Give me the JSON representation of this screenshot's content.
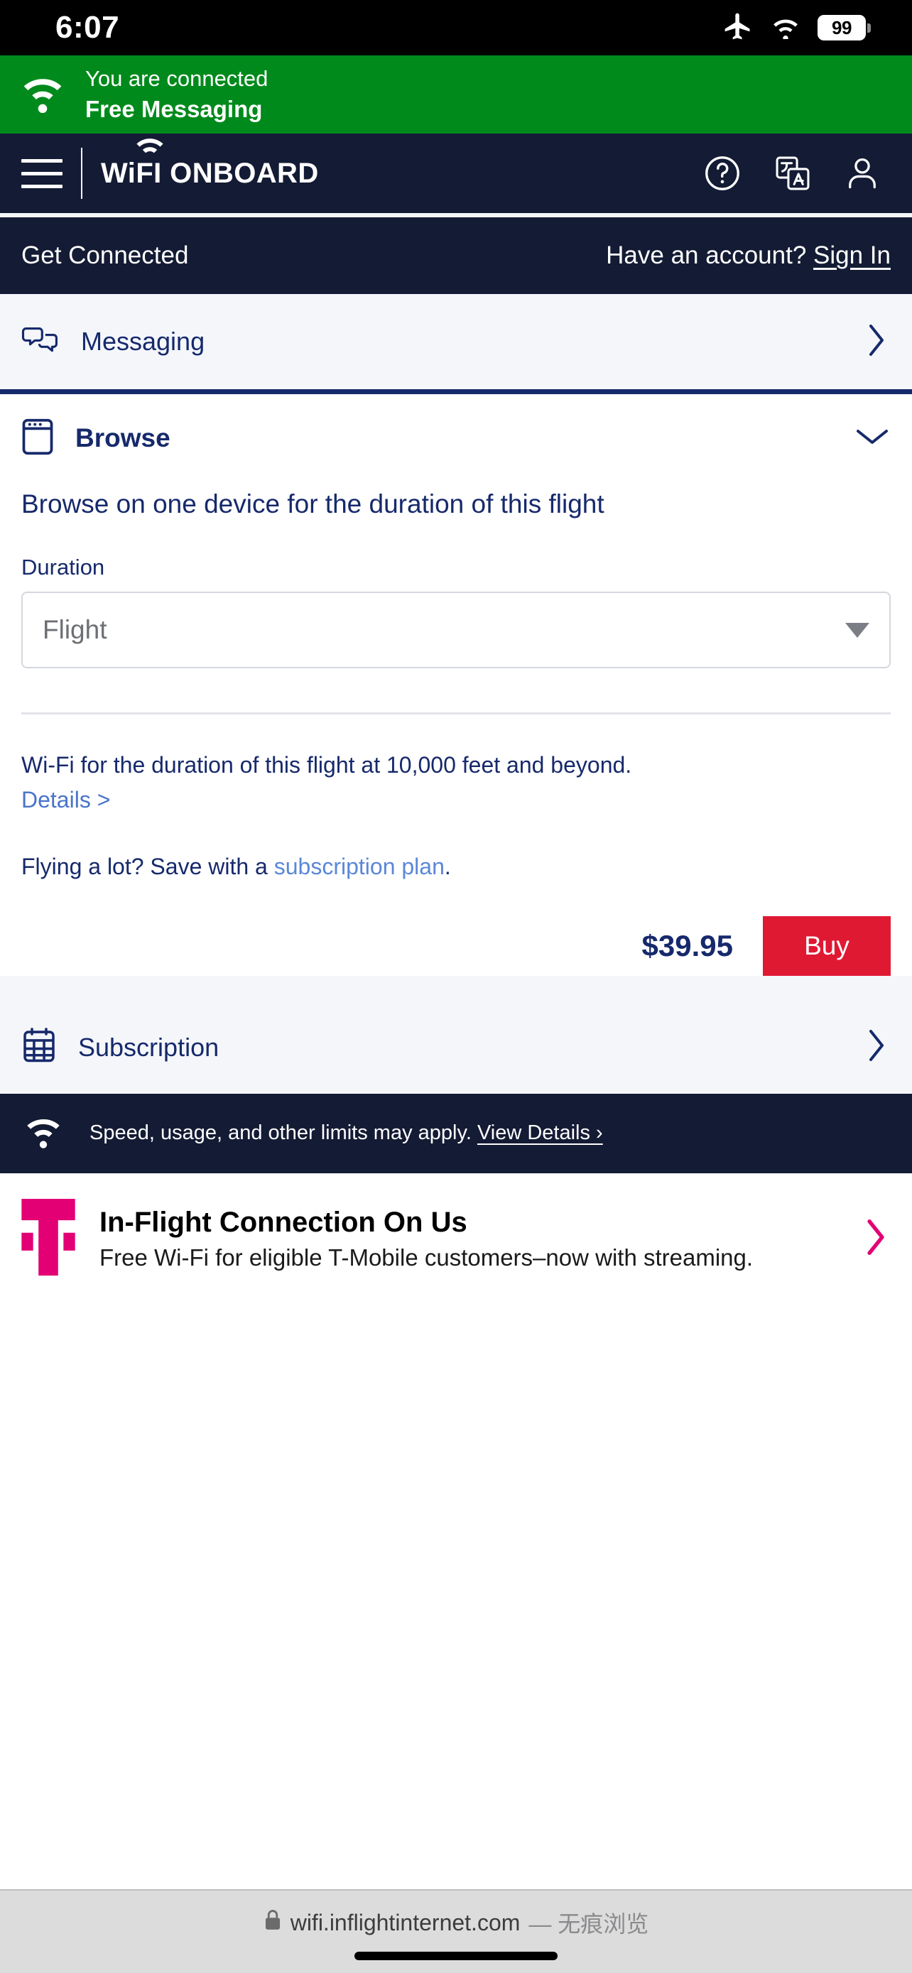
{
  "status_bar": {
    "time": "6:07",
    "icons": [
      "airplane-mode-icon",
      "wifi-icon"
    ],
    "battery_level": "99"
  },
  "connected_banner": {
    "icon": "wifi-icon",
    "line1": "You are connected",
    "line2": "Free Messaging",
    "background": "#008A1C"
  },
  "header": {
    "menu_icon": "hamburger-menu-icon",
    "brand": "WiFI ONBOARD",
    "icons": [
      {
        "name": "help-icon",
        "label": "?"
      },
      {
        "name": "translate-icon",
        "label": "文A"
      },
      {
        "name": "account-icon",
        "label": "person"
      }
    ],
    "background": "#141B34"
  },
  "subnav": {
    "title": "Get Connected",
    "account_prompt": "Have an account?",
    "sign_in": "Sign In"
  },
  "messaging_row": {
    "icon": "chat-bubbles-icon",
    "label": "Messaging",
    "chevron": "chevron-right-icon"
  },
  "browse": {
    "icon": "browser-window-icon",
    "title": "Browse",
    "chevron": "chevron-down-icon",
    "lead": "Browse on one device for the duration of this flight",
    "duration_label": "Duration",
    "duration_value": "Flight",
    "duration_options": [
      "Flight"
    ],
    "description": "Wi-Fi for the duration of this flight at 10,000 feet and beyond.",
    "details_link": "Details >",
    "subscription_prompt_prefix": "Flying a lot? Save with a ",
    "subscription_link": "subscription plan",
    "subscription_prompt_suffix": ".",
    "price": "$39.95",
    "buy_label": "Buy",
    "buy_color": "#E01933"
  },
  "subscription_row": {
    "icon": "calendar-icon",
    "label": "Subscription",
    "chevron": "chevron-right-icon"
  },
  "limits_footer": {
    "icon": "wifi-icon",
    "text": "Speed, usage, and other limits may apply.",
    "link": "View Details ›"
  },
  "promo": {
    "logo": "t-mobile-logo",
    "title": "In-Flight Connection On Us",
    "subtitle": "Free Wi-Fi for eligible T-Mobile customers–now with streaming.",
    "chevron": "chevron-right-icon",
    "accent": "#E20074"
  },
  "browser_bar": {
    "lock_icon": "lock-icon",
    "url": "wifi.inflightinternet.com",
    "mode": "— 无痕浏览"
  }
}
